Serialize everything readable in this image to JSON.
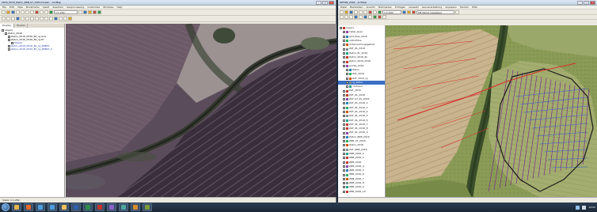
{
  "left": {
    "title": "2016_0516_Zaton_ZRB_07_Orthomosaic - ArcMap",
    "menu": [
      "File",
      "Edit",
      "View",
      "Bookmarks",
      "Insert",
      "Selection",
      "Geoprocessing",
      "Customize",
      "Windows",
      "Help"
    ],
    "scale": "1:1,259",
    "tabs": [
      "Display",
      "Source"
    ],
    "toc": [
      {
        "label": "Layers",
        "indent": 0
      },
      {
        "label": "Zaton_2016",
        "indent": 1
      },
      {
        "label": "Zaton_2016_0516_B1_rg.ecw",
        "indent": 2
      },
      {
        "label": "Zaton_2016_0516_B1_rg.tif",
        "indent": 2
      },
      {
        "label": "Mosaic",
        "indent": 3
      },
      {
        "label": "Zaton_2016_0516_B1_rg_ZRB07",
        "indent": 2
      },
      {
        "label": "Zaton_2016_0516_B1_rg_ZRB07_2",
        "indent": 2
      }
    ],
    "status": [
      "Scale: 1:1,259",
      "",
      "",
      "",
      "",
      "",
      "",
      "",
      "",
      ""
    ]
  },
  "right": {
    "title": "ZATON_2016 - ArcMap",
    "menu": [
      "Datei",
      "Bearbeiten",
      "Ansicht",
      "Textmarken",
      "Einfügen",
      "Auswahl",
      "Geoverarbeitung",
      "Anpassen",
      "Fenster",
      "Hilfe"
    ],
    "scale_label": "1:2,500",
    "layer_dropdown": "Mit Name Gewässer",
    "toc": [
      {
        "label": "Layers",
        "indent": 0
      },
      {
        "label": "Label_layer",
        "indent": 1
      },
      {
        "label": "grid_tiles_2016",
        "indent": 1
      },
      {
        "label": "orthofotos",
        "indent": 1
      },
      {
        "label": "Untersuchungsgebiet",
        "indent": 1
      },
      {
        "label": "ZAT_ZL_2016",
        "indent": 1
      },
      {
        "label": "Zaton_ZL_2016",
        "indent": 1
      },
      {
        "label": "Zaton_2016_ZL",
        "indent": 1
      },
      {
        "label": "Zaton_2016_0516",
        "indent": 1
      },
      {
        "label": "points_2016",
        "indent": 1
      },
      {
        "label": "Zaton",
        "indent": 2
      },
      {
        "label": "ZAT_2016",
        "indent": 2
      },
      {
        "label": "ZAT_2016_rg",
        "indent": 2
      },
      {
        "label": "rg_Zaton",
        "indent": 2
      },
      {
        "label": "contours",
        "indent": 2
      },
      {
        "label": "ZAT_2016",
        "indent": 1
      },
      {
        "label": "ZAT_ZL_2016",
        "indent": 1
      },
      {
        "label": "ZAT_07_ZL_2016",
        "indent": 1
      },
      {
        "label": "ZAT_ZL_2016_2",
        "indent": 1
      },
      {
        "label": "ZAT_ZL_2016_3",
        "indent": 1
      },
      {
        "label": "ZAT_ZL_2016_4",
        "indent": 1
      },
      {
        "label": "ZAT_ZL_2016_5",
        "indent": 1
      },
      {
        "label": "ZAT_ZL_2016_6",
        "indent": 1
      },
      {
        "label": "ZAT_ZL_2016_7",
        "indent": 1
      },
      {
        "label": "ZAT_ZL_2016_8",
        "indent": 1
      },
      {
        "label": "ZAT_ZL_2016_9",
        "indent": 1
      },
      {
        "label": "Zaton_ZRB_2016",
        "indent": 1
      },
      {
        "label": "ZRB_07_2016",
        "indent": 1
      },
      {
        "label": "Zaton_2016",
        "indent": 1
      },
      {
        "label": "ZAT_ZRB_2016",
        "indent": 1
      },
      {
        "label": "ZRB_2016_2",
        "indent": 1
      },
      {
        "label": "ZRB_2016_3",
        "indent": 1
      },
      {
        "label": "ZRB_2016",
        "indent": 1
      },
      {
        "label": "ZRB_2016_4",
        "indent": 1
      },
      {
        "label": "ZRB_2016_5",
        "indent": 1
      },
      {
        "label": "ZRB_2016_6",
        "indent": 1
      },
      {
        "label": "ZRB_2016_7",
        "indent": 1
      },
      {
        "label": "ZRB_2016_8",
        "indent": 1
      },
      {
        "label": "ZRB_2016_9",
        "indent": 1
      },
      {
        "label": "ZRB_2016_10",
        "indent": 1
      }
    ],
    "status": "",
    "selected_index": 13
  },
  "taskbar": {
    "clock": "14:02",
    "date": "",
    "apps": [
      {
        "name": "explorer",
        "color": "#e5b54b"
      },
      {
        "name": "firefox",
        "color": "#e66a2c"
      },
      {
        "name": "arcmap",
        "color": "#4d9ee0"
      },
      {
        "name": "arcmap2",
        "color": "#4d9ee0"
      },
      {
        "name": "folder",
        "color": "#f0c05a"
      },
      {
        "name": "word",
        "color": "#2f5fae"
      },
      {
        "name": "excel",
        "color": "#2f8e4a"
      },
      {
        "name": "pdf",
        "color": "#c9342d"
      },
      {
        "name": "app9",
        "color": "#8f63c9"
      },
      {
        "name": "app10",
        "color": "#4fa7a0"
      },
      {
        "name": "app11",
        "color": "#d98b2b"
      },
      {
        "name": "app12",
        "color": "#7b9b3a"
      }
    ]
  }
}
